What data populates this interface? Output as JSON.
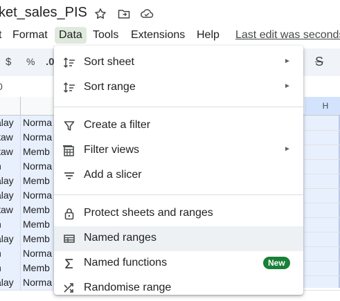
{
  "app": {
    "doc_title": "ket_sales_PIS",
    "menus": [
      "t",
      "Format",
      "Data",
      "Tools",
      "Extensions",
      "Help"
    ],
    "active_menu": "Data",
    "last_edit": "Last edit was seconds"
  },
  "toolbar": {
    "currency": "$",
    "percent": "%",
    "decimal": ".0",
    "strike": "S"
  },
  "formula_bar": {
    "cell_ref": "0"
  },
  "grid": {
    "column_header": "H",
    "rows": [
      {
        "a": "alay",
        "b": "Norma"
      },
      {
        "a": "itaw",
        "b": "Norma"
      },
      {
        "a": "itaw",
        "b": "Memb"
      },
      {
        "a": "n",
        "b": "Norma"
      },
      {
        "a": "alay",
        "b": "Memb"
      },
      {
        "a": "alay",
        "b": "Norma"
      },
      {
        "a": "itaw",
        "b": "Memb"
      },
      {
        "a": "n",
        "b": "Memb"
      },
      {
        "a": "alay",
        "b": "Memb"
      },
      {
        "a": "n",
        "b": "Norma"
      },
      {
        "a": "n",
        "b": "Memb"
      },
      {
        "a": "alay",
        "b": "Norma"
      }
    ]
  },
  "data_menu": {
    "items": [
      {
        "label": "Sort sheet",
        "icon": "sort-icon",
        "submenu": true
      },
      {
        "label": "Sort range",
        "icon": "sort-icon",
        "submenu": true
      },
      {
        "label": "Create a filter",
        "icon": "filter-icon",
        "submenu": false
      },
      {
        "label": "Filter views",
        "icon": "filter-views-icon",
        "submenu": true
      },
      {
        "label": "Add a slicer",
        "icon": "slicer-icon",
        "submenu": false
      },
      {
        "label": "Protect sheets and ranges",
        "icon": "lock-icon",
        "submenu": false
      },
      {
        "label": "Named ranges",
        "icon": "table-icon",
        "submenu": false
      },
      {
        "label": "Named functions",
        "icon": "sigma-icon",
        "submenu": false,
        "badge": "New"
      },
      {
        "label": "Randomise range",
        "icon": "shuffle-icon",
        "submenu": false
      }
    ],
    "highlighted": "Named ranges"
  },
  "colors": {
    "accent_green": "#188038",
    "active_menu_bg": "#dfeadd",
    "selection_bg": "#e8f0fe"
  }
}
